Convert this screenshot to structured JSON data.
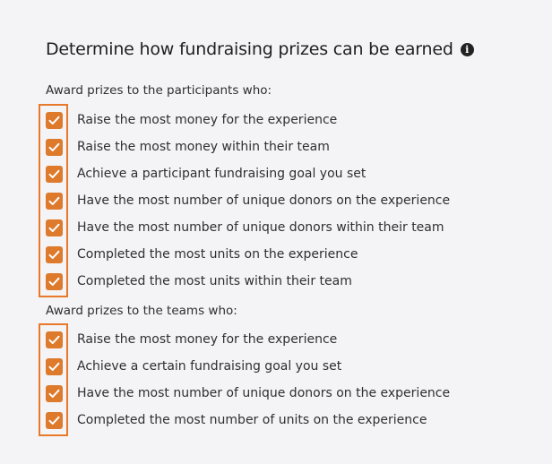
{
  "title": "Determine how fundraising prizes can be earned",
  "info_icon": "info-icon",
  "accent_color": "#e8782a",
  "participants": {
    "label": "Award prizes to the participants who:",
    "options": [
      {
        "label": "Raise the most money for the experience",
        "checked": true
      },
      {
        "label": "Raise the most money within their team",
        "checked": true
      },
      {
        "label": "Achieve a participant fundraising goal you set",
        "checked": true
      },
      {
        "label": "Have the most number of unique donors on the experience",
        "checked": true
      },
      {
        "label": "Have the most number of unique donors within their team",
        "checked": true
      },
      {
        "label": "Completed the most units on the experience",
        "checked": true
      },
      {
        "label": "Completed the most units within their team",
        "checked": true
      }
    ]
  },
  "teams": {
    "label": "Award prizes to the teams who:",
    "options": [
      {
        "label": "Raise the most money for the experience",
        "checked": true
      },
      {
        "label": "Achieve a certain fundraising goal you set",
        "checked": true
      },
      {
        "label": "Have the most number of unique donors on the experience",
        "checked": true
      },
      {
        "label": "Completed the most number of units on the experience",
        "checked": true
      }
    ]
  }
}
